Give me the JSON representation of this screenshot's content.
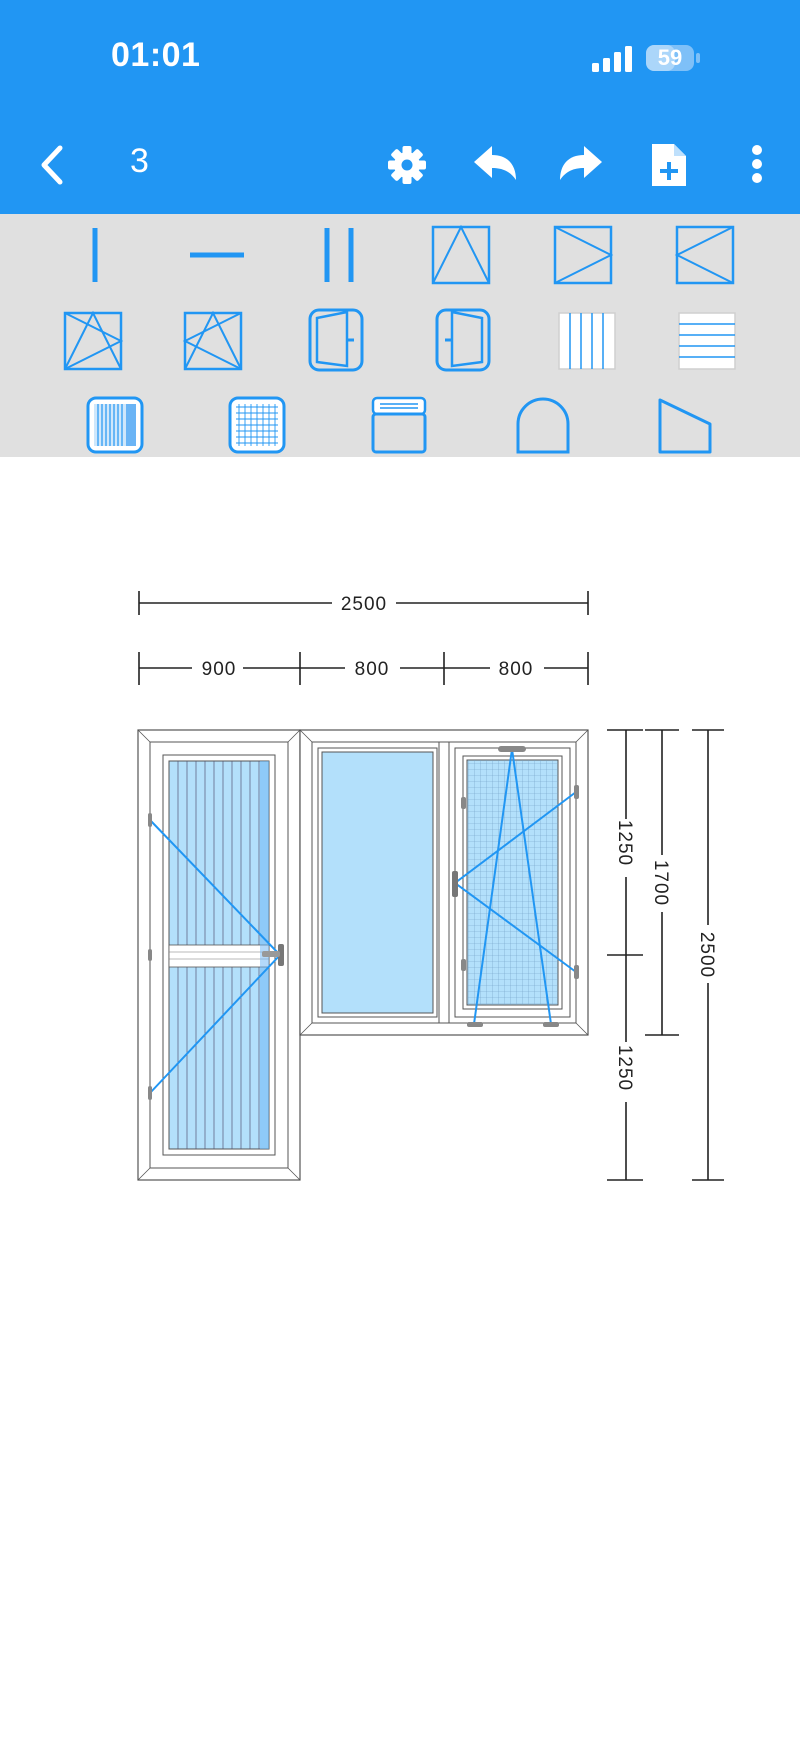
{
  "status_bar": {
    "time": "01:01",
    "battery": "59"
  },
  "toolbar": {
    "title": "3"
  },
  "drawing": {
    "total_width": "2500",
    "sections": [
      "900",
      "800",
      "800"
    ],
    "heights": {
      "upper": "1250",
      "lower": "1250",
      "window": "1700",
      "total": "2500"
    }
  },
  "colors": {
    "primary": "#2196f3",
    "palette_bg": "#e0e0e0",
    "glass": "#b3e0fb"
  }
}
